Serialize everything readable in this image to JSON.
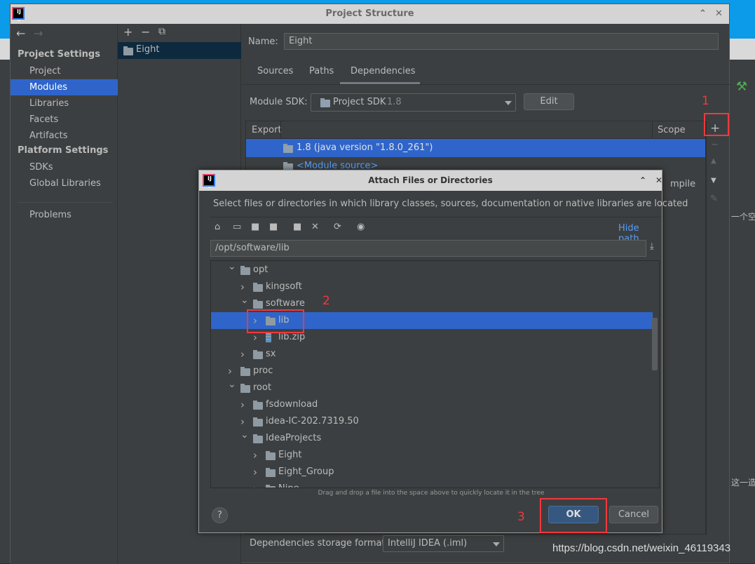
{
  "window": {
    "title": "Project Structure"
  },
  "sidebar": {
    "project_settings": "Project Settings",
    "items": [
      "Project",
      "Modules",
      "Libraries",
      "Facets",
      "Artifacts"
    ],
    "platform_settings": "Platform Settings",
    "platform_items": [
      "SDKs",
      "Global Libraries"
    ],
    "problems": "Problems",
    "selected": "Modules"
  },
  "modules": {
    "items": [
      "Eight"
    ]
  },
  "module": {
    "name_label": "Name:",
    "name_value": "Eight",
    "tabs": [
      "Sources",
      "Paths",
      "Dependencies"
    ],
    "active_tab": "Dependencies",
    "sdk_label": "Module SDK:",
    "sdk_value": "Project SDK",
    "sdk_version": "1.8",
    "edit": "Edit",
    "col_export": "Export",
    "col_scope": "Scope",
    "deps": [
      "1.8 (java version \"1.8.0_261\")",
      "<Module source>"
    ],
    "scope_partial": "mpile",
    "storage_label": "Dependencies storage format:",
    "storage_value": "IntelliJ IDEA (.iml)"
  },
  "dialog": {
    "title": "Attach Files or Directories",
    "description": "Select files or directories in which library classes, sources, documentation or native libraries are located",
    "hide_path": "Hide path",
    "path": "/opt/software/lib",
    "hint": "Drag and drop a file into the space above to quickly locate it in the tree",
    "ok": "OK",
    "cancel": "Cancel",
    "help": "?",
    "tree": [
      {
        "label": "opt",
        "level": 0,
        "expanded": true
      },
      {
        "label": "kingsoft",
        "level": 1,
        "expanded": false
      },
      {
        "label": "software",
        "level": 1,
        "expanded": true
      },
      {
        "label": "lib",
        "level": 2,
        "expanded": false,
        "selected": true
      },
      {
        "label": "lib.zip",
        "level": 2,
        "expanded": false,
        "zip": true
      },
      {
        "label": "sx",
        "level": 1,
        "expanded": false
      },
      {
        "label": "proc",
        "level": 0,
        "expanded": false
      },
      {
        "label": "root",
        "level": 0,
        "expanded": true
      },
      {
        "label": "fsdownload",
        "level": 1,
        "expanded": false
      },
      {
        "label": "idea-IC-202.7319.50",
        "level": 1,
        "expanded": false
      },
      {
        "label": "IdeaProjects",
        "level": 1,
        "expanded": true
      },
      {
        "label": "Eight",
        "level": 2,
        "expanded": false
      },
      {
        "label": "Eight_Group",
        "level": 2,
        "expanded": false
      },
      {
        "label": "Nine",
        "level": 2,
        "expanded": false
      }
    ]
  },
  "annotations": {
    "step1": "1",
    "step2": "2",
    "step3": "3"
  },
  "watermark": "https://blog.csdn.net/weixin_46119343",
  "background_text": [
    "一个空",
    "这一造"
  ],
  "colors": {
    "selection": "#2f65ca",
    "panel": "#3c3f41",
    "annotation": "#f0383c",
    "ok_button": "#365880"
  }
}
